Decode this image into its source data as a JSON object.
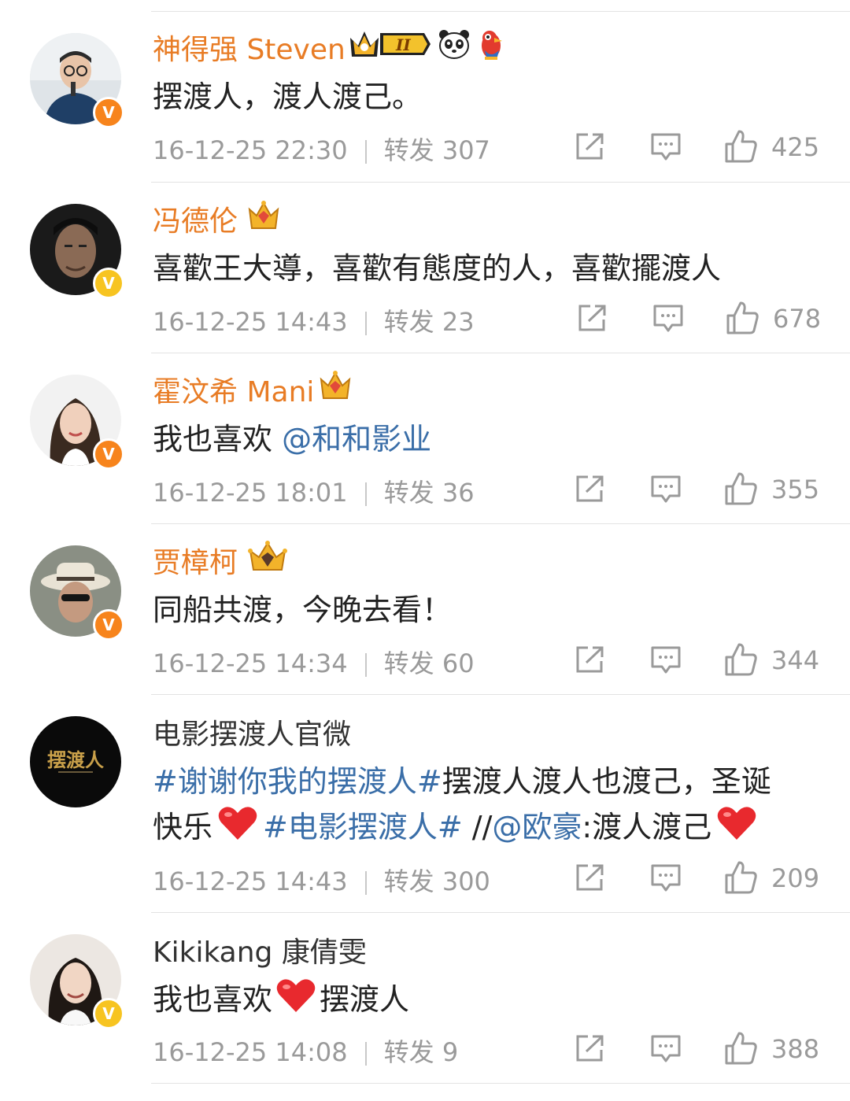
{
  "comments": [
    {
      "name": "神得强 Steven",
      "text": "摆渡人，渡人渡己。",
      "time": "16-12-25 22:30",
      "repost_label": "转发",
      "repost_count": "307",
      "likes": "425",
      "badges": [
        "crown-level-2-icon",
        "panda-icon",
        "parrot-icon"
      ],
      "level": "II"
    },
    {
      "name": "冯德伦",
      "text": "喜歡王大導，喜歡有態度的人，喜歡擺渡人",
      "time": "16-12-25 14:43",
      "repost_label": "转发",
      "repost_count": "23",
      "likes": "678",
      "badges": [
        "crown-gem-icon"
      ]
    },
    {
      "name": "霍汶希 Mani",
      "text_pre": "我也喜欢 ",
      "mention": "@和和影业",
      "time": "16-12-25 18:01",
      "repost_label": "转发",
      "repost_count": "36",
      "likes": "355",
      "badges": [
        "crown-gem-icon"
      ]
    },
    {
      "name": "贾樟柯",
      "text": "同船共渡，今晚去看！",
      "time": "16-12-25 14:34",
      "repost_label": "转发",
      "repost_count": "60",
      "likes": "344",
      "badges": [
        "crown-diamond-icon"
      ]
    },
    {
      "name": "电影摆渡人官微",
      "line1_tag": "#谢谢你我的摆渡人#",
      "line1_rest": "摆渡人渡人也渡己，圣诞",
      "line2_a": "快乐",
      "line2_tag": "#电影摆渡人#",
      "line2_b": " //",
      "line2_mention": "@欧豪",
      "line2_c": ":渡人渡己",
      "time": "16-12-25 14:43",
      "repost_label": "转发",
      "repost_count": "300",
      "likes": "209",
      "logo_text": "摆渡人"
    },
    {
      "name": "Kikikang 康倩雯",
      "text_a": "我也喜欢",
      "text_b": "摆渡人",
      "time": "16-12-25 14:08",
      "repost_label": "转发",
      "repost_count": "9",
      "likes": "388"
    }
  ],
  "colors": {
    "vip_name": "#e87c25",
    "link": "#3a6ea8",
    "meta": "#9a9a9a",
    "badge_orange": "#f7841c",
    "badge_gold": "#f7c421",
    "heart": "#e8292e"
  },
  "verified_mark": "V"
}
